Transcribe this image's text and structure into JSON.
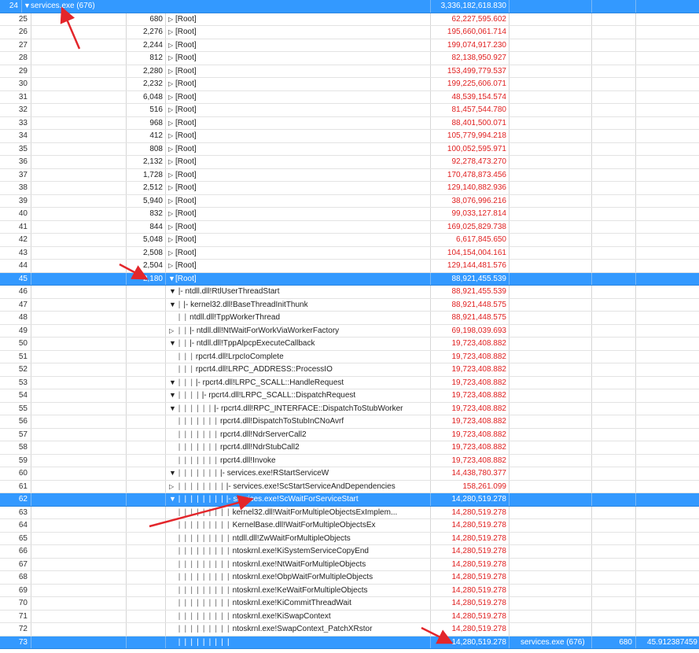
{
  "rows": [
    {
      "n": "24",
      "pid": "",
      "depth": 0,
      "tog": "expanded",
      "text": "services.exe (676)",
      "weight": "3,336,182,618.830",
      "sel": true,
      "first": true,
      "proc": "",
      "tid": "",
      "pct": ""
    },
    {
      "n": "25",
      "pid": "680",
      "depth": 0,
      "tog": "collapsed",
      "text": "[Root]",
      "weight": "62,227,595.602"
    },
    {
      "n": "26",
      "pid": "2,276",
      "depth": 0,
      "tog": "collapsed",
      "text": "[Root]",
      "weight": "195,660,061.714"
    },
    {
      "n": "27",
      "pid": "2,244",
      "depth": 0,
      "tog": "collapsed",
      "text": "[Root]",
      "weight": "199,074,917.230"
    },
    {
      "n": "28",
      "pid": "812",
      "depth": 0,
      "tog": "collapsed",
      "text": "[Root]",
      "weight": "82,138,950.927"
    },
    {
      "n": "29",
      "pid": "2,280",
      "depth": 0,
      "tog": "collapsed",
      "text": "[Root]",
      "weight": "153,499,779.537"
    },
    {
      "n": "30",
      "pid": "2,232",
      "depth": 0,
      "tog": "collapsed",
      "text": "[Root]",
      "weight": "199,225,606.071"
    },
    {
      "n": "31",
      "pid": "6,048",
      "depth": 0,
      "tog": "collapsed",
      "text": "[Root]",
      "weight": "48,539,154.574"
    },
    {
      "n": "32",
      "pid": "516",
      "depth": 0,
      "tog": "collapsed",
      "text": "[Root]",
      "weight": "81,457,544.780"
    },
    {
      "n": "33",
      "pid": "968",
      "depth": 0,
      "tog": "collapsed",
      "text": "[Root]",
      "weight": "88,401,500.071"
    },
    {
      "n": "34",
      "pid": "412",
      "depth": 0,
      "tog": "collapsed",
      "text": "[Root]",
      "weight": "105,779,994.218"
    },
    {
      "n": "35",
      "pid": "808",
      "depth": 0,
      "tog": "collapsed",
      "text": "[Root]",
      "weight": "100,052,595.971"
    },
    {
      "n": "36",
      "pid": "2,132",
      "depth": 0,
      "tog": "collapsed",
      "text": "[Root]",
      "weight": "92,278,473.270"
    },
    {
      "n": "37",
      "pid": "1,728",
      "depth": 0,
      "tog": "collapsed",
      "text": "[Root]",
      "weight": "170,478,873.456"
    },
    {
      "n": "38",
      "pid": "2,512",
      "depth": 0,
      "tog": "collapsed",
      "text": "[Root]",
      "weight": "129,140,882.936"
    },
    {
      "n": "39",
      "pid": "5,940",
      "depth": 0,
      "tog": "collapsed",
      "text": "[Root]",
      "weight": "38,076,996.216"
    },
    {
      "n": "40",
      "pid": "832",
      "depth": 0,
      "tog": "collapsed",
      "text": "[Root]",
      "weight": "99,033,127.814"
    },
    {
      "n": "41",
      "pid": "844",
      "depth": 0,
      "tog": "collapsed",
      "text": "[Root]",
      "weight": "169,025,829.738"
    },
    {
      "n": "42",
      "pid": "5,048",
      "depth": 0,
      "tog": "collapsed",
      "text": "[Root]",
      "weight": "6,617,845.650"
    },
    {
      "n": "43",
      "pid": "2,508",
      "depth": 0,
      "tog": "collapsed",
      "text": "[Root]",
      "weight": "104,154,004.161"
    },
    {
      "n": "44",
      "pid": "2,504",
      "depth": 0,
      "tog": "collapsed",
      "text": "[Root]",
      "weight": "129,144,481.576"
    },
    {
      "n": "45",
      "pid": "2,180",
      "depth": 0,
      "tog": "expanded",
      "text": "[Root]",
      "weight": "88,921,455.539",
      "sel": true
    },
    {
      "n": "46",
      "pid": "",
      "depth": 1,
      "tog": "expanded",
      "text": "|- ntdll.dll!RtlUserThreadStart",
      "weight": "88,921,455.539"
    },
    {
      "n": "47",
      "pid": "",
      "depth": 1,
      "tog": "expanded",
      "text": "|- kernel32.dll!BaseThreadInitThunk",
      "weight": "88,921,448.575",
      "guides": "|"
    },
    {
      "n": "48",
      "pid": "",
      "depth": 1,
      "tog": "none",
      "text": "ntdll.dll!TppWorkerThread",
      "weight": "88,921,448.575",
      "guides": "| |"
    },
    {
      "n": "49",
      "pid": "",
      "depth": 1,
      "tog": "collapsed",
      "text": "|- ntdll.dll!NtWaitForWorkViaWorkerFactory",
      "weight": "69,198,039.693",
      "guides": "| |"
    },
    {
      "n": "50",
      "pid": "",
      "depth": 1,
      "tog": "expanded",
      "text": "|- ntdll.dll!TppAlpcpExecuteCallback",
      "weight": "19,723,408.882",
      "guides": "| |"
    },
    {
      "n": "51",
      "pid": "",
      "depth": 1,
      "tog": "none",
      "text": "rpcrt4.dll!LrpcIoComplete",
      "weight": "19,723,408.882",
      "guides": "| | |"
    },
    {
      "n": "52",
      "pid": "",
      "depth": 1,
      "tog": "none",
      "text": "rpcrt4.dll!LRPC_ADDRESS::ProcessIO",
      "weight": "19,723,408.882",
      "guides": "| | |"
    },
    {
      "n": "53",
      "pid": "",
      "depth": 1,
      "tog": "expanded",
      "text": "|- rpcrt4.dll!LRPC_SCALL::HandleRequest",
      "weight": "19,723,408.882",
      "guides": "| | |"
    },
    {
      "n": "54",
      "pid": "",
      "depth": 1,
      "tog": "expanded",
      "text": "|- rpcrt4.dll!LRPC_SCALL::DispatchRequest",
      "weight": "19,723,408.882",
      "guides": "| | | |"
    },
    {
      "n": "55",
      "pid": "",
      "depth": 1,
      "tog": "expanded",
      "text": "|- rpcrt4.dll!RPC_INTERFACE::DispatchToStubWorker",
      "weight": "19,723,408.882",
      "guides": "| | | | | |"
    },
    {
      "n": "56",
      "pid": "",
      "depth": 1,
      "tog": "none",
      "text": "rpcrt4.dll!DispatchToStubInCNoAvrf",
      "weight": "19,723,408.882",
      "guides": "| | | | | | |"
    },
    {
      "n": "57",
      "pid": "",
      "depth": 1,
      "tog": "none",
      "text": "rpcrt4.dll!NdrServerCall2",
      "weight": "19,723,408.882",
      "guides": "| | | | | | |"
    },
    {
      "n": "58",
      "pid": "",
      "depth": 1,
      "tog": "none",
      "text": "rpcrt4.dll!NdrStubCall2",
      "weight": "19,723,408.882",
      "guides": "| | | | | | |"
    },
    {
      "n": "59",
      "pid": "",
      "depth": 1,
      "tog": "none",
      "text": "rpcrt4.dll!Invoke",
      "weight": "19,723,408.882",
      "guides": "| | | | | | |"
    },
    {
      "n": "60",
      "pid": "",
      "depth": 1,
      "tog": "expanded",
      "text": "|- services.exe!RStartServiceW",
      "weight": "14,438,780.377",
      "guides": "| | | | | | |"
    },
    {
      "n": "61",
      "pid": "",
      "depth": 1,
      "tog": "collapsed",
      "text": "|- services.exe!ScStartServiceAndDependencies",
      "weight": "158,261.099",
      "guides": "| | | | | | | |"
    },
    {
      "n": "62",
      "pid": "",
      "depth": 1,
      "tog": "expanded",
      "text": "|- services.exe!ScWaitForServiceStart",
      "weight": "14,280,519.278",
      "guides": "| | | | | | | |",
      "sel": true
    },
    {
      "n": "63",
      "pid": "",
      "depth": 1,
      "tog": "none",
      "text": "kernel32.dll!WaitForMultipleObjectsExImplem...",
      "weight": "14,280,519.278",
      "guides": "| | | | | | | | |"
    },
    {
      "n": "64",
      "pid": "",
      "depth": 1,
      "tog": "none",
      "text": "KernelBase.dll!WaitForMultipleObjectsEx",
      "weight": "14,280,519.278",
      "guides": "| | | | | | | | |"
    },
    {
      "n": "65",
      "pid": "",
      "depth": 1,
      "tog": "none",
      "text": "ntdll.dll!ZwWaitForMultipleObjects",
      "weight": "14,280,519.278",
      "guides": "| | | | | | | | |"
    },
    {
      "n": "66",
      "pid": "",
      "depth": 1,
      "tog": "none",
      "text": "ntoskrnl.exe!KiSystemServiceCopyEnd",
      "weight": "14,280,519.278",
      "guides": "| | | | | | | | |"
    },
    {
      "n": "67",
      "pid": "",
      "depth": 1,
      "tog": "none",
      "text": "ntoskrnl.exe!NtWaitForMultipleObjects",
      "weight": "14,280,519.278",
      "guides": "| | | | | | | | |"
    },
    {
      "n": "68",
      "pid": "",
      "depth": 1,
      "tog": "none",
      "text": "ntoskrnl.exe!ObpWaitForMultipleObjects",
      "weight": "14,280,519.278",
      "guides": "| | | | | | | | |"
    },
    {
      "n": "69",
      "pid": "",
      "depth": 1,
      "tog": "none",
      "text": "ntoskrnl.exe!KeWaitForMultipleObjects",
      "weight": "14,280,519.278",
      "guides": "| | | | | | | | |"
    },
    {
      "n": "70",
      "pid": "",
      "depth": 1,
      "tog": "none",
      "text": "ntoskrnl.exe!KiCommitThreadWait",
      "weight": "14,280,519.278",
      "guides": "| | | | | | | | |"
    },
    {
      "n": "71",
      "pid": "",
      "depth": 1,
      "tog": "none",
      "text": "ntoskrnl.exe!KiSwapContext",
      "weight": "14,280,519.278",
      "guides": "| | | | | | | | |"
    },
    {
      "n": "72",
      "pid": "",
      "depth": 1,
      "tog": "none",
      "text": "ntoskrnl.exe!SwapContext_PatchXRstor",
      "weight": "14,280,519.278",
      "guides": "| | | | | | | | |"
    },
    {
      "n": "73",
      "pid": "",
      "depth": 1,
      "tog": "none",
      "text": "",
      "weight": "14,280,519.278",
      "guides": "| | | | | | | | |",
      "sel": true,
      "proc": "services.exe (676)",
      "tid": "680",
      "pct": "45.912387459"
    }
  ],
  "annotation_color": "#e3262b",
  "icons": {
    "expanded": "triangle-down-icon",
    "collapsed": "triangle-right-icon"
  }
}
